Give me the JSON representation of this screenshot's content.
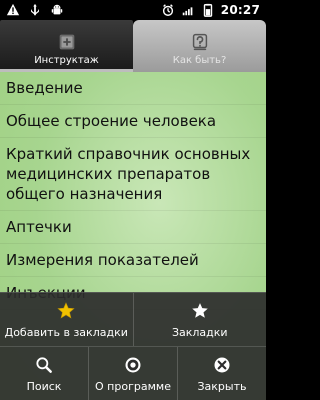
{
  "status_bar": {
    "time": "20:27",
    "icons": [
      "warning-icon",
      "usb-icon",
      "android-debug-icon",
      "alarm-icon",
      "signal-icon",
      "battery-icon"
    ]
  },
  "tabs": [
    {
      "label": "Инструктаж",
      "icon": "book-icon",
      "active": true
    },
    {
      "label": "Как быть?",
      "icon": "help-pictogram-icon",
      "active": false
    }
  ],
  "list": {
    "items": [
      "Введение",
      "Общее строение человека",
      "Краткий справочник основных медицинских препаратов общего назначения",
      "Аптечки",
      "Измерения показателей",
      "Инъекции"
    ]
  },
  "menu": {
    "items": [
      {
        "label": "Добавить в закладки",
        "icon": "star-gold-icon"
      },
      {
        "label": "Закладки",
        "icon": "star-icon"
      },
      {
        "label": "Поиск",
        "icon": "search-icon"
      },
      {
        "label": "О программе",
        "icon": "info-icon"
      },
      {
        "label": "Закрыть",
        "icon": "close-icon"
      }
    ]
  },
  "colors": {
    "content_bg": "#a7d58f",
    "menu_bg": "#2d2d2d",
    "status_bg": "#000000",
    "star_gold": "#f2c200"
  }
}
